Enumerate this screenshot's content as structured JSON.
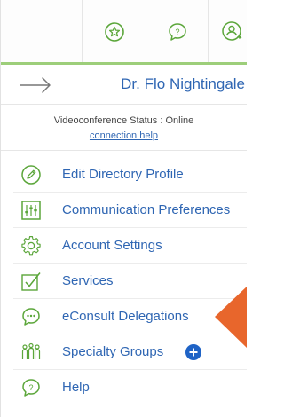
{
  "colors": {
    "accent_green": "#5ba63a",
    "link_blue": "#2f66b3",
    "plus_blue": "#1f63c6",
    "orange_arrow": "#e8662c"
  },
  "toolbar": {
    "icons": [
      "star-badge-icon",
      "chat-question-icon",
      "user-cycle-icon"
    ]
  },
  "header": {
    "back_icon": "right-arrow-icon",
    "doctor_name": "Dr. Flo Nightingale"
  },
  "status": {
    "label": "Videoconference Status : ",
    "value": "Online",
    "help_link": "connection help"
  },
  "menu": {
    "items": [
      {
        "label": "Edit Directory Profile",
        "icon": "pencil-circle-icon"
      },
      {
        "label": "Communication Preferences",
        "icon": "sliders-icon"
      },
      {
        "label": "Account Settings",
        "icon": "gear-icon"
      },
      {
        "label": "Services",
        "icon": "checkbox-icon"
      },
      {
        "label": "eConsult Delegations",
        "icon": "chat-bubble-dots-icon"
      },
      {
        "label": "Specialty Groups",
        "icon": "group-people-icon"
      },
      {
        "label": "Help",
        "icon": "help-bubble-icon"
      }
    ]
  }
}
